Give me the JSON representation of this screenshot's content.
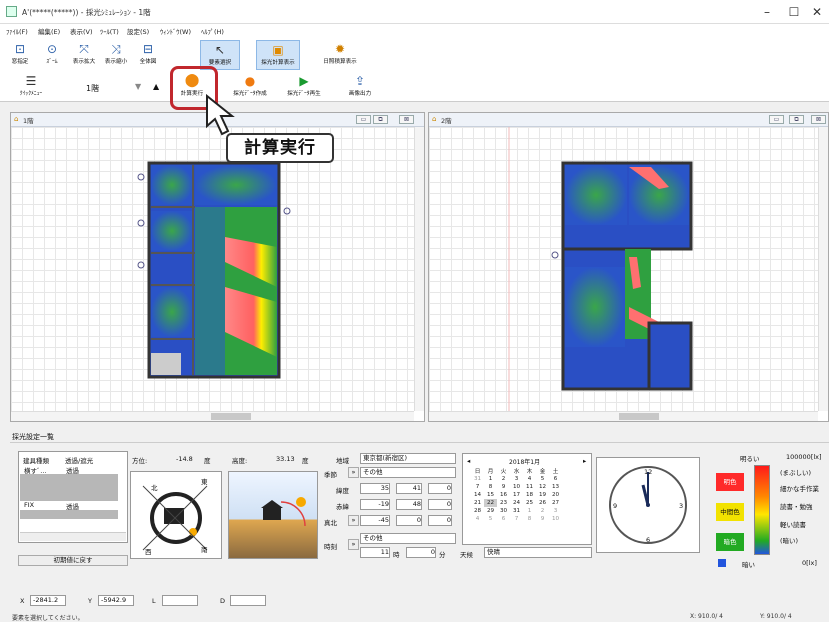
{
  "window": {
    "title": "A'(*****(*****)) - 採光ｼﾐｭﾚｰｼｮﾝ - 1階"
  },
  "menu": [
    "ﾌｧｲﾙ(F)",
    "編集(E)",
    "表示(V)",
    "ﾂｰﾙ(T)",
    "設定(S)",
    "ｳｨﾝﾄﾞｳ(W)",
    "ﾍﾙﾌﾟ(H)"
  ],
  "toolbar": {
    "row1": [
      {
        "label": "窓指定",
        "icon": "window-select-icon"
      },
      {
        "label": "ｽﾞｰﾑ",
        "icon": "zoom-icon"
      },
      {
        "label": "表示拡大",
        "icon": "zoom-in-icon"
      },
      {
        "label": "表示縮小",
        "icon": "zoom-out-icon"
      },
      {
        "label": "全体図",
        "icon": "fit-icon"
      },
      {
        "label": "要素選択",
        "icon": "cursor-icon"
      },
      {
        "label": "採光計算表示",
        "icon": "light-calc-display-icon"
      },
      {
        "label": "日照積算表示",
        "icon": "sunlight-accumulate-icon"
      }
    ],
    "row2": [
      {
        "label": "ｸｲｯｸﾒﾆｭｰ",
        "icon": "menu-icon"
      },
      {
        "label": "計算実行",
        "icon": "calculate-icon"
      },
      {
        "label": "採光ﾃﾞｰﾀ作成",
        "icon": "data-create-icon"
      },
      {
        "label": "採光ﾃﾞｰﾀ再生",
        "icon": "play-icon"
      },
      {
        "label": "画像出力",
        "icon": "export-image-icon"
      }
    ],
    "floor": "1階"
  },
  "callout": "計算実行",
  "views": {
    "left_title": "1階",
    "right_title": "2階"
  },
  "settings": {
    "title": "採光設定一覧",
    "table_headers": [
      "建具種類",
      "透過/遮光"
    ],
    "rows": [
      {
        "type": "横すﾞ...",
        "val": "透過"
      },
      {
        "type": "",
        "val": ""
      },
      {
        "type": "",
        "val": ""
      },
      {
        "type": "",
        "val": ""
      },
      {
        "type": "FIX",
        "val": "透過"
      }
    ],
    "reset_button": "初期値に戻す",
    "azimuth_label": "方位:",
    "azimuth_value": "-14.8",
    "azimuth_unit": "度",
    "altitude_label": "高度:",
    "altitude_value": "33.13",
    "altitude_unit": "度",
    "compass": {
      "north": "北",
      "east": "東",
      "west": "西",
      "south": "南"
    },
    "region_label": "地域",
    "region_value": "東京都(新宿区)",
    "season_label": "季節",
    "season_value": "その他",
    "lat_label": "緯度",
    "lat": [
      "35",
      "41",
      "0"
    ],
    "red_label": "赤緯",
    "red": [
      "-19",
      "48",
      "0"
    ],
    "north_label": "真北",
    "north": [
      "-45",
      "0",
      "0"
    ],
    "time_label": "時刻",
    "time_mode": "その他",
    "hour": "11",
    "hour_unit": "時",
    "minute": "0",
    "minute_unit": "分",
    "weather_label": "天候",
    "weather_value": "快晴",
    "calendar": {
      "title": "2018年1月",
      "weekdays": [
        "日",
        "月",
        "火",
        "水",
        "木",
        "金",
        "土"
      ],
      "weeks": [
        [
          "31",
          "1",
          "2",
          "3",
          "4",
          "5",
          "6"
        ],
        [
          "7",
          "8",
          "9",
          "10",
          "11",
          "12",
          "13"
        ],
        [
          "14",
          "15",
          "16",
          "17",
          "18",
          "19",
          "20"
        ],
        [
          "21",
          "22",
          "23",
          "24",
          "25",
          "26",
          "27"
        ],
        [
          "28",
          "29",
          "30",
          "31",
          "1",
          "2",
          "3"
        ],
        [
          "4",
          "5",
          "6",
          "7",
          "8",
          "9",
          "10"
        ]
      ],
      "selected": "22"
    },
    "clock": {
      "hour": 11,
      "minute": 0,
      "numbers": [
        "12",
        "3",
        "6",
        "9"
      ]
    },
    "legend": {
      "bright": "明るい",
      "dark": "暗い",
      "levels": [
        {
          "label": "明色",
          "color": "#ff2a2a"
        },
        {
          "label": "中間色",
          "color": "#f2e200"
        },
        {
          "label": "暗色",
          "color": "#22aa22"
        }
      ],
      "top_value": "100000[lx]",
      "descriptions": [
        "(まぶしい)",
        "細かな手作業",
        "読書・勉強",
        "軽い読書",
        "(暗い)"
      ],
      "bottom_value": "0[lx]"
    }
  },
  "coords": {
    "x_label": "X",
    "x": "-2841.2",
    "y_label": "Y",
    "y": "-5942.9",
    "l_label": "L",
    "d_label": "D"
  },
  "status": {
    "message": "要素を選択してください。",
    "x": "X: 910.0/ 4",
    "y": "Y: 910.0/ 4"
  }
}
